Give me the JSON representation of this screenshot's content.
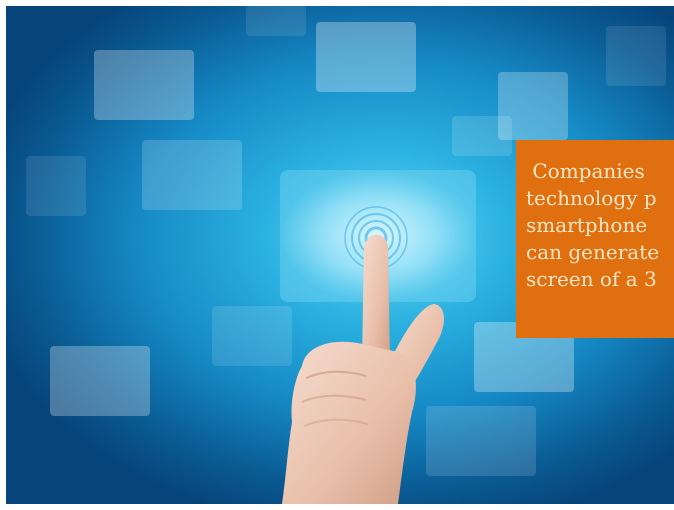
{
  "caption": {
    "text": " Companies\ntechnology p\nsmartphone\ncan generate\nscreen of a 3",
    "background_color": "#e0700f",
    "text_color": "#fde6c8"
  },
  "photo": {
    "subject": "hand-touching-virtual-screen",
    "accent_color": "#2ab0e0"
  }
}
